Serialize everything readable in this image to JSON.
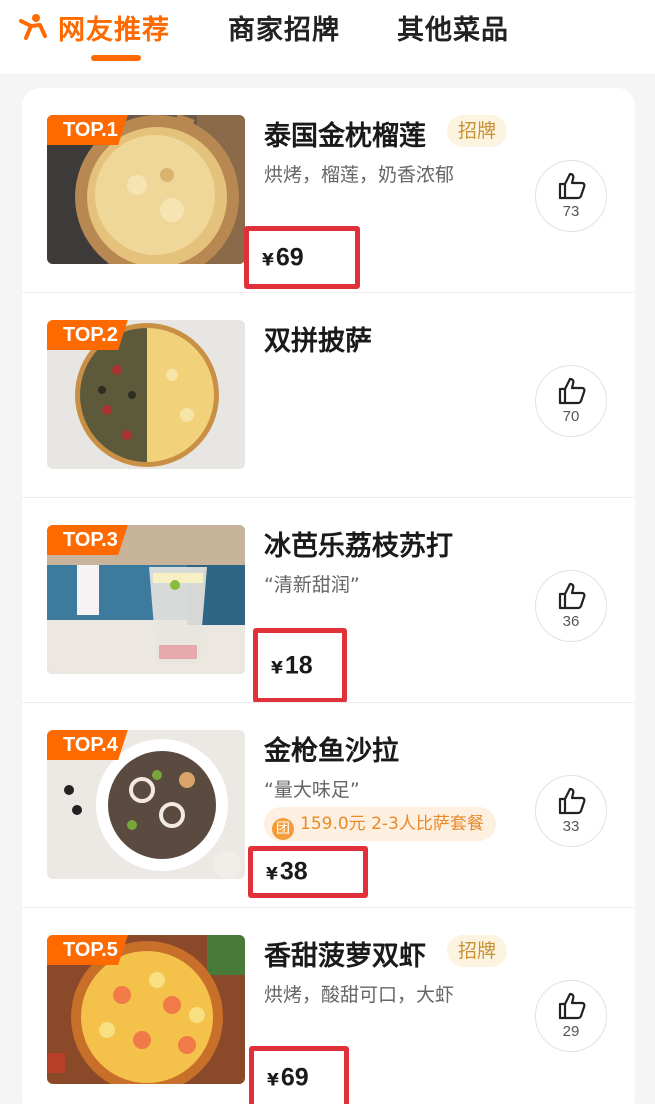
{
  "tabs": [
    {
      "label": "网友推荐",
      "active": true
    },
    {
      "label": "商家招牌",
      "active": false
    },
    {
      "label": "其他菜品",
      "active": false
    }
  ],
  "colors": {
    "accent": "#ff6a00",
    "highlight_box": "#e0303a",
    "badge_bg": "#fdf3e1",
    "badge_text": "#c89232"
  },
  "icons": {
    "brand": "person-cheer-icon",
    "like": "thumbs-up-icon",
    "promo": "group-buy-icon"
  },
  "items": [
    {
      "rank": "TOP.1",
      "name": "泰国金枕榴莲",
      "badge": "招牌",
      "desc": "烘烤，榴莲，奶香浓郁",
      "currency": "¥",
      "price": "69",
      "likes": "73"
    },
    {
      "rank": "TOP.2",
      "name": "双拼披萨",
      "likes": "70"
    },
    {
      "rank": "TOP.3",
      "name": "冰芭乐荔枝苏打",
      "desc": "“清新甜润”",
      "currency": "¥",
      "price": "18",
      "likes": "36"
    },
    {
      "rank": "TOP.4",
      "name": "金枪鱼沙拉",
      "desc": "“量大味足”",
      "promo": {
        "icon": "团",
        "text": "159.0元 2-3人比萨套餐"
      },
      "currency": "¥",
      "price": "38",
      "likes": "33"
    },
    {
      "rank": "TOP.5",
      "name": "香甜菠萝双虾",
      "badge": "招牌",
      "desc": "烘烤，酸甜可口，大虾",
      "currency": "¥",
      "price": "69",
      "likes": "29"
    }
  ]
}
